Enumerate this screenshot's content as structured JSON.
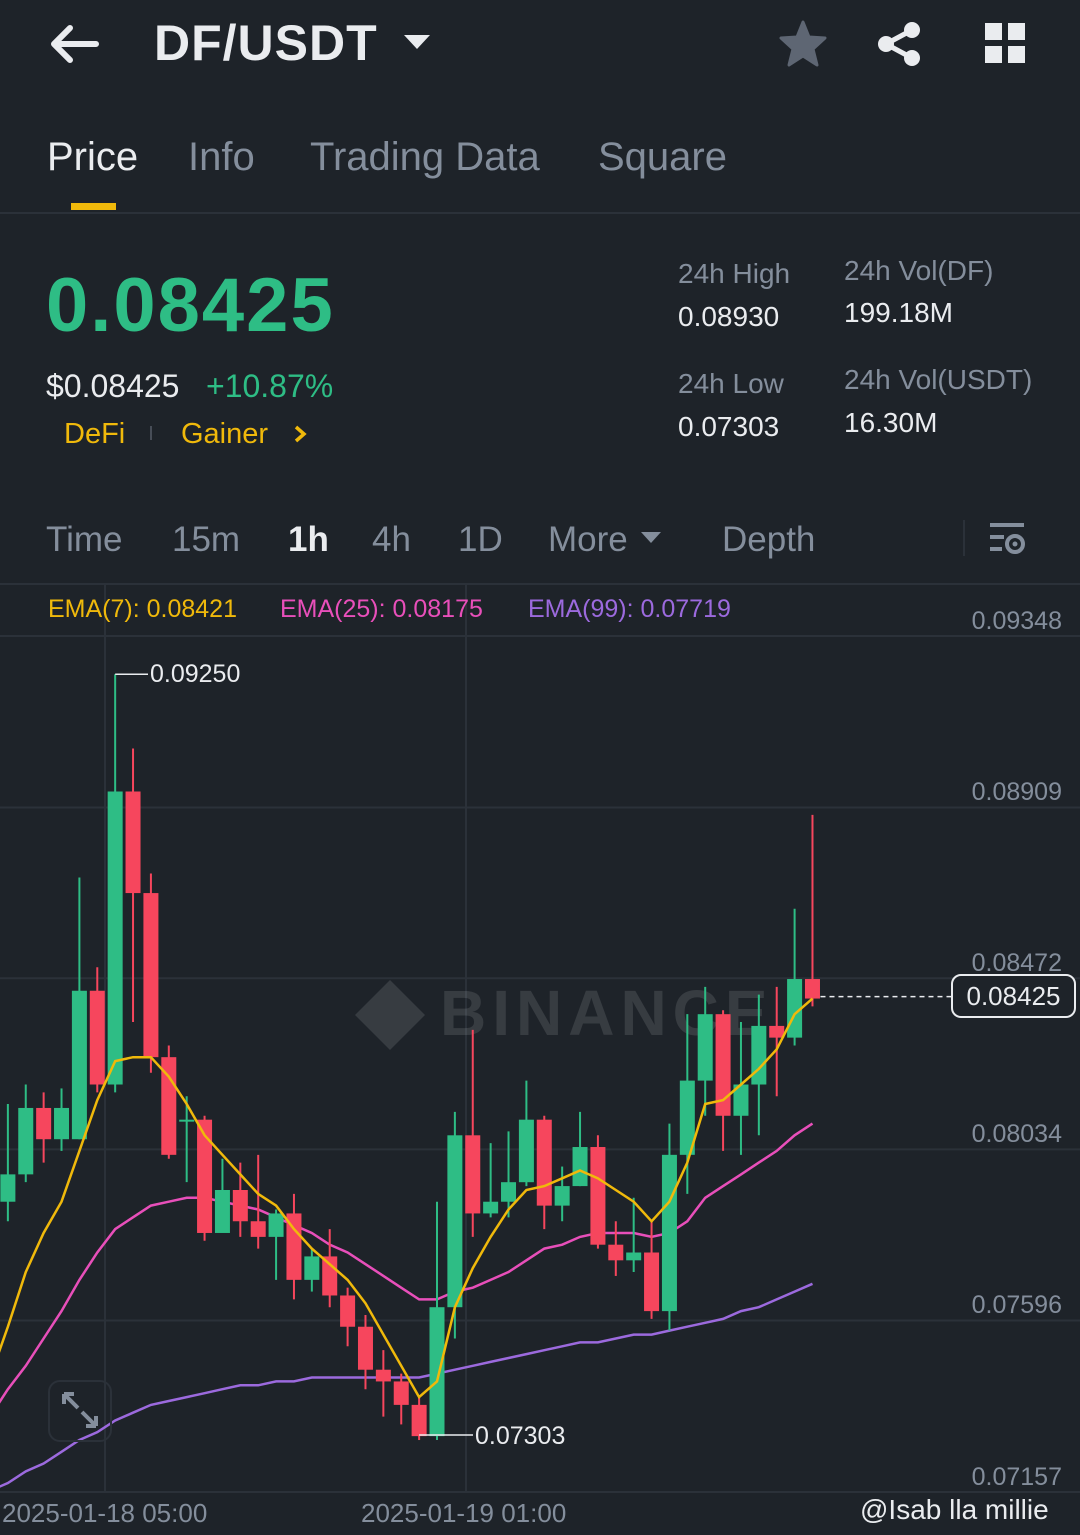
{
  "header": {
    "title": "DF/USDT",
    "back_icon": "arrow-left-icon",
    "dropdown_icon": "caret-down-icon",
    "star_icon": "star-icon",
    "share_icon": "share-icon",
    "grid_icon": "grid-icon"
  },
  "tabs": [
    {
      "label": "Price",
      "active": true
    },
    {
      "label": "Info",
      "active": false
    },
    {
      "label": "Trading Data",
      "active": false
    },
    {
      "label": "Square",
      "active": false
    }
  ],
  "ticker": {
    "last_price": "0.08425",
    "usd_price": "$0.08425",
    "change_pct": "+10.87%",
    "tags": [
      "DeFi",
      "Gainer"
    ],
    "high_label": "24h High",
    "high_value": "0.08930",
    "low_label": "24h Low",
    "low_value": "0.07303",
    "vol_base_label": "24h Vol(DF)",
    "vol_base_value": "199.18M",
    "vol_quote_label": "24h Vol(USDT)",
    "vol_quote_value": "16.30M"
  },
  "intervals": [
    {
      "label": "Time",
      "active": false
    },
    {
      "label": "15m",
      "active": false
    },
    {
      "label": "1h",
      "active": true
    },
    {
      "label": "4h",
      "active": false
    },
    {
      "label": "1D",
      "active": false
    },
    {
      "label": "More",
      "active": false
    },
    {
      "label": "Depth",
      "active": false
    }
  ],
  "chart_settings_icon": "chart-settings-icon",
  "ema": {
    "ema7": "EMA(7): 0.08421",
    "ema25": "EMA(25): 0.08175",
    "ema99": "EMA(99): 0.07719"
  },
  "colors": {
    "up": "#2ebd85",
    "down": "#f6465d",
    "ema7": "#f0b90b",
    "ema25": "#e84fba",
    "ema99": "#9c6ade",
    "accent": "#f0b90b"
  },
  "chart_data": {
    "type": "candlestick",
    "ylim": [
      0.07157,
      0.09348
    ],
    "y_ticks": [
      "0.09348",
      "0.08909",
      "0.08472",
      "0.08034",
      "0.07596",
      "0.07157"
    ],
    "x_labels": [
      "2025-01-18 05:00",
      "2025-01-19 01:00"
    ],
    "high_marker": "0.09250",
    "low_marker": "0.07303",
    "current_price": "0.08425",
    "candles": [
      [
        0.0771,
        0.079,
        0.08,
        0.0755
      ],
      [
        0.079,
        0.0797,
        0.0815,
        0.0785
      ],
      [
        0.0797,
        0.0814,
        0.082,
        0.0795
      ],
      [
        0.0814,
        0.0806,
        0.0818,
        0.08
      ],
      [
        0.0806,
        0.0814,
        0.0819,
        0.0803
      ],
      [
        0.0806,
        0.0844,
        0.0873,
        0.0806
      ],
      [
        0.0844,
        0.082,
        0.085,
        0.0818
      ],
      [
        0.082,
        0.0895,
        0.0925,
        0.0818
      ],
      [
        0.0895,
        0.0869,
        0.0906,
        0.0836
      ],
      [
        0.0869,
        0.0827,
        0.0874,
        0.0823
      ],
      [
        0.0827,
        0.0802,
        0.083,
        0.0801
      ],
      [
        0.0811,
        0.0811,
        0.0817,
        0.0795
      ],
      [
        0.0811,
        0.0782,
        0.0812,
        0.078
      ],
      [
        0.0782,
        0.0793,
        0.0801,
        0.0784
      ],
      [
        0.0793,
        0.0785,
        0.08,
        0.0781
      ],
      [
        0.0785,
        0.0781,
        0.0802,
        0.0778
      ],
      [
        0.0781,
        0.0787,
        0.0788,
        0.077
      ],
      [
        0.0787,
        0.077,
        0.0792,
        0.0765
      ],
      [
        0.077,
        0.0776,
        0.0778,
        0.0767
      ],
      [
        0.0776,
        0.0766,
        0.0783,
        0.0763
      ],
      [
        0.0766,
        0.0758,
        0.0768,
        0.0753
      ],
      [
        0.0758,
        0.0747,
        0.0761,
        0.0742
      ],
      [
        0.0747,
        0.0744,
        0.0752,
        0.0735
      ],
      [
        0.0744,
        0.0738,
        0.0746,
        0.0733
      ],
      [
        0.0738,
        0.073,
        0.074,
        0.0729
      ],
      [
        0.073,
        0.0763,
        0.079,
        0.0729
      ],
      [
        0.0763,
        0.0807,
        0.0813,
        0.0755
      ],
      [
        0.0807,
        0.0787,
        0.0834,
        0.0781
      ],
      [
        0.0787,
        0.079,
        0.0805,
        0.0786
      ],
      [
        0.079,
        0.0795,
        0.0808,
        0.0786
      ],
      [
        0.0795,
        0.0811,
        0.0821,
        0.0794
      ],
      [
        0.0811,
        0.0789,
        0.0812,
        0.0783
      ],
      [
        0.0789,
        0.0794,
        0.0799,
        0.0785
      ],
      [
        0.0794,
        0.0804,
        0.0813,
        0.0794
      ],
      [
        0.0804,
        0.0779,
        0.0807,
        0.0778
      ],
      [
        0.0779,
        0.0775,
        0.0785,
        0.0771
      ],
      [
        0.0775,
        0.0777,
        0.0791,
        0.0772
      ],
      [
        0.0777,
        0.0762,
        0.0785,
        0.076
      ],
      [
        0.0762,
        0.0802,
        0.081,
        0.0757
      ],
      [
        0.0802,
        0.0821,
        0.0838,
        0.0792
      ],
      [
        0.0821,
        0.0838,
        0.0845,
        0.0812
      ],
      [
        0.0838,
        0.0812,
        0.0839,
        0.0803
      ],
      [
        0.0812,
        0.082,
        0.0836,
        0.0802
      ],
      [
        0.082,
        0.0835,
        0.0843,
        0.0807
      ],
      [
        0.0835,
        0.0832,
        0.0845,
        0.0817
      ],
      [
        0.0832,
        0.0847,
        0.0865,
        0.083
      ],
      [
        0.0847,
        0.0842,
        0.0889,
        0.084
      ]
    ],
    "ema7_line": [
      0.0745,
      0.0758,
      0.0772,
      0.0782,
      0.079,
      0.0803,
      0.0816,
      0.0826,
      0.0827,
      0.0827,
      0.0822,
      0.0815,
      0.0807,
      0.0802,
      0.0797,
      0.0792,
      0.0789,
      0.0783,
      0.0778,
      0.0774,
      0.077,
      0.0764,
      0.0756,
      0.0748,
      0.074,
      0.0744,
      0.0763,
      0.0773,
      0.0781,
      0.0788,
      0.0793,
      0.0794,
      0.0796,
      0.0798,
      0.0796,
      0.0793,
      0.079,
      0.0785,
      0.079,
      0.08,
      0.0815,
      0.0816,
      0.082,
      0.0824,
      0.0829,
      0.0838,
      0.0842
    ],
    "ema25_line": [
      0.0735,
      0.0742,
      0.0748,
      0.0755,
      0.0762,
      0.077,
      0.0777,
      0.0783,
      0.0786,
      0.0789,
      0.079,
      0.0791,
      0.0791,
      0.079,
      0.0789,
      0.0788,
      0.0786,
      0.0784,
      0.0782,
      0.0779,
      0.0777,
      0.0774,
      0.0771,
      0.0768,
      0.0765,
      0.0765,
      0.0767,
      0.0768,
      0.077,
      0.0772,
      0.0775,
      0.0778,
      0.0779,
      0.0781,
      0.0782,
      0.0782,
      0.0782,
      0.0781,
      0.0782,
      0.0785,
      0.0791,
      0.0794,
      0.0797,
      0.08,
      0.0803,
      0.0807,
      0.081
    ],
    "ema99_line": [
      0.0716,
      0.0718,
      0.0721,
      0.0723,
      0.0726,
      0.0729,
      0.0731,
      0.0734,
      0.0736,
      0.0738,
      0.0739,
      0.074,
      0.0741,
      0.0742,
      0.0743,
      0.0743,
      0.0744,
      0.0744,
      0.0745,
      0.0745,
      0.0745,
      0.0745,
      0.0745,
      0.0745,
      0.0745,
      0.0746,
      0.0747,
      0.0748,
      0.0749,
      0.075,
      0.0751,
      0.0752,
      0.0753,
      0.0754,
      0.0754,
      0.0755,
      0.0756,
      0.0756,
      0.0757,
      0.0758,
      0.0759,
      0.076,
      0.0762,
      0.0763,
      0.0765,
      0.0767,
      0.0769
    ]
  },
  "watermark": "@Isab  lla millie"
}
